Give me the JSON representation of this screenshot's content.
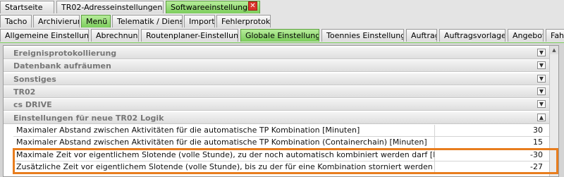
{
  "tabs_row1": {
    "items": [
      {
        "label": "Startseite"
      },
      {
        "label": "TR02-Adresseinstellungen"
      },
      {
        "label": "Softwareeinstellungen"
      }
    ]
  },
  "tabs_row2": {
    "items": [
      {
        "label": "Tacho"
      },
      {
        "label": "Archivierung"
      },
      {
        "label": "Menü"
      },
      {
        "label": "Telematik / Dienste"
      },
      {
        "label": "Import"
      },
      {
        "label": "Fehlerprotokoll"
      }
    ]
  },
  "tabs_row3": {
    "items": [
      {
        "label": "Allgemeine Einstellungen"
      },
      {
        "label": "Abrechnung"
      },
      {
        "label": "Routenplaner-Einstellungen"
      },
      {
        "label": "Globale Einstellungen"
      },
      {
        "label": "Toennies Einstellungen"
      },
      {
        "label": "Auftrag"
      },
      {
        "label": "Auftragsvorlagen"
      },
      {
        "label": "Angebote"
      },
      {
        "label": "Fah"
      }
    ]
  },
  "sections": [
    {
      "label": "Ereignisprotokollierung",
      "state": "collapsed"
    },
    {
      "label": "Datenbank aufräumen",
      "state": "collapsed"
    },
    {
      "label": "Sonstiges",
      "state": "collapsed"
    },
    {
      "label": "TR02",
      "state": "collapsed"
    },
    {
      "label": "cs DRIVE",
      "state": "collapsed"
    },
    {
      "label": "Einstellungen für neue TR02 Logik",
      "state": "expanded"
    }
  ],
  "properties": [
    {
      "label": "Maximaler Abstand zwischen Aktivitäten für die automatische TP Kombination [Minuten]",
      "value": "30"
    },
    {
      "label": "Maximaler Abstand zwischen Aktivitäten für die automatische TP Kombination (Containerchain) [Minuten]",
      "value": "15"
    },
    {
      "label": "Maximale Zeit vor eigentlichem Slotende (volle Stunde), zu der noch automatisch kombiniert werden darf [Minuten]",
      "value": "-30"
    },
    {
      "label": "Zusätzliche Zeit vor eigentlichem Slotende (volle Stunde), bis zu der für eine Kombination storniert werden darf [Minuten]",
      "value": "-27"
    }
  ],
  "colors": {
    "active_tab": "#7ccd5c",
    "highlight": "#e87d1e",
    "close_button": "#d9342b"
  },
  "icons": {
    "close": "close-icon",
    "collapsed": "chevron-down-icon",
    "expanded": "chevron-up-icon"
  }
}
